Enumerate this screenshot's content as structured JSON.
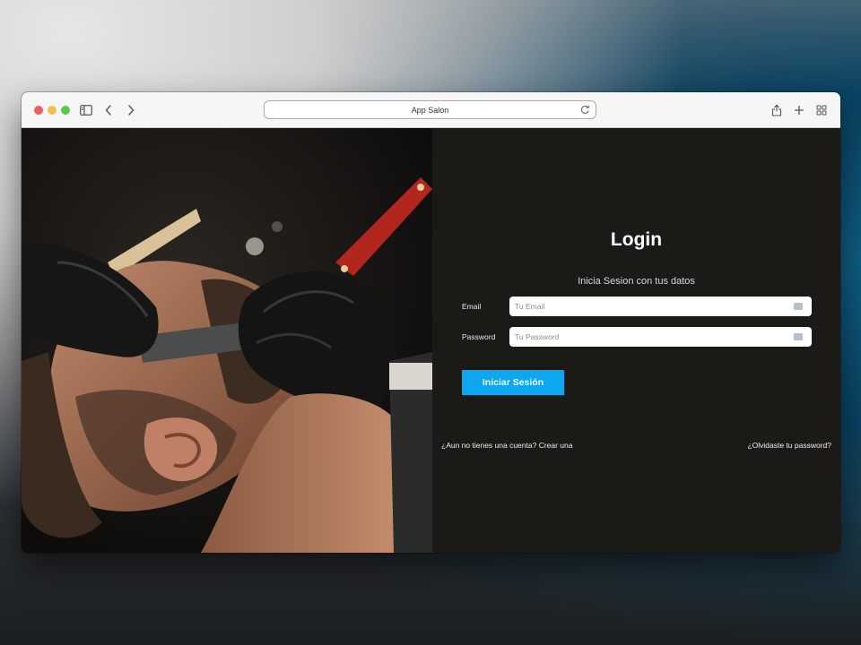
{
  "browser": {
    "address_text": "App Salon",
    "icons": [
      "sidebar-icon",
      "back-chevron-icon",
      "forward-chevron-icon",
      "reload-icon",
      "share-icon",
      "new-tab-plus-icon",
      "tab-overview-icon"
    ]
  },
  "hero_image": {
    "subject": "barber shaving a man's beard with a straight razor, black gloves"
  },
  "login": {
    "title": "Login",
    "subtitle": "Inicia Sesion con tus datos",
    "email_label": "Email",
    "email_placeholder": "Tu Email",
    "email_value": "",
    "password_label": "Password",
    "password_placeholder": "Tu Password",
    "password_value": "",
    "submit_label": "Iniciar Sesión",
    "create_account_link": "¿Aun no tienes una cuenta? Crear una",
    "forgot_password_link": "¿Olvidaste tu password?"
  },
  "colors": {
    "panel_bg": "#1b1a17",
    "button_bg": "#0da6ef",
    "text": "#ffffff"
  }
}
